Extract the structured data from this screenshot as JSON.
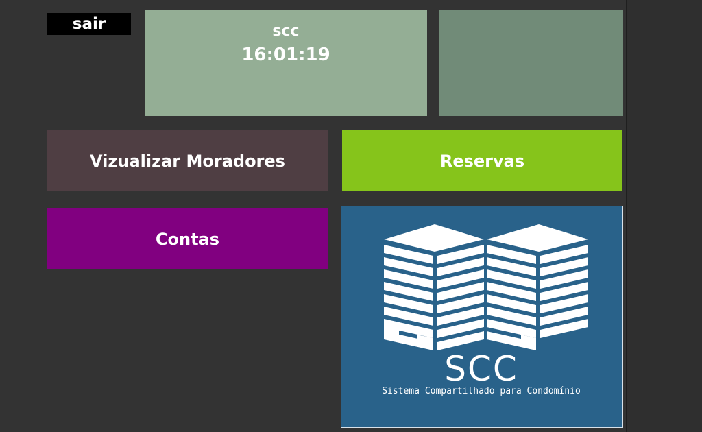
{
  "header": {
    "logout_label": "sair",
    "app_name": "scc",
    "clock": "16:01:19"
  },
  "menu": {
    "residents_label": "Vizualizar Moradores",
    "reservations_label": "Reservas",
    "accounts_label": "Contas"
  },
  "logo": {
    "title": "SCC",
    "subtitle": "Sistema Compartilhado para Condomínio"
  },
  "colors": {
    "background": "#333333",
    "clock_tile": "#94ae95",
    "blank_tile": "#718b78",
    "residents_button": "#4f3e43",
    "reservations_button": "#86c41b",
    "accounts_button": "#810080",
    "logo_background": "#29628a"
  }
}
